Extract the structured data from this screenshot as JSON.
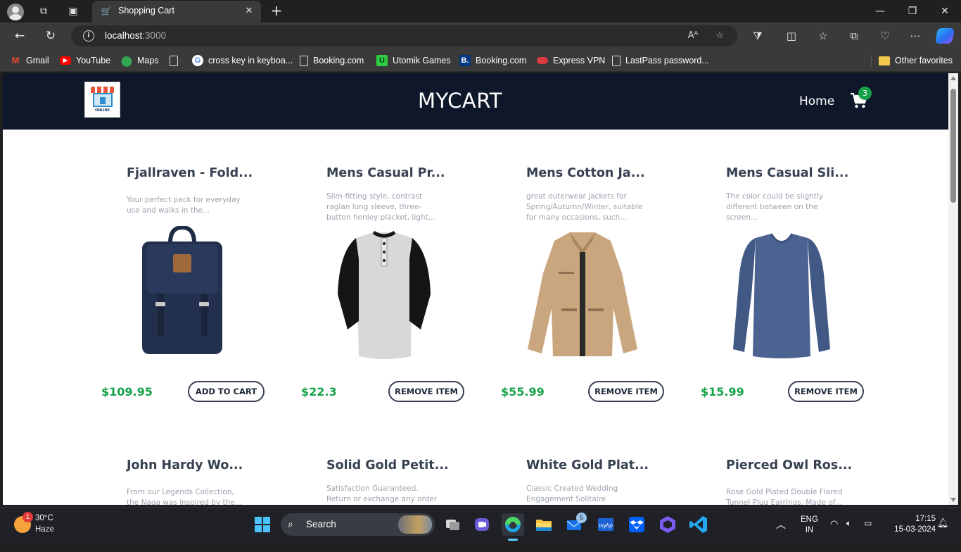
{
  "browser": {
    "tab_title": "Shopping Cart",
    "address_host": "localhost",
    "address_port": ":3000",
    "bookmarks": [
      {
        "label": "Gmail",
        "icon": "gmail-icon",
        "color": "#ea4335"
      },
      {
        "label": "YouTube",
        "icon": "youtube-icon",
        "color": "#ff0000"
      },
      {
        "label": "Maps",
        "icon": "maps-icon",
        "color": "#34a853"
      },
      {
        "label": "",
        "icon": "page-icon",
        "color": "#dcdcdc"
      },
      {
        "label": "cross key in keyboa...",
        "icon": "google-icon",
        "color": "#4285f4"
      },
      {
        "label": "Booking.com",
        "icon": "page-icon",
        "color": "#dcdcdc"
      },
      {
        "label": "Utomik Games",
        "icon": "utomik-icon",
        "color": "#2ecc40"
      },
      {
        "label": "Booking.com",
        "icon": "booking-icon",
        "color": "#003580"
      },
      {
        "label": "Express VPN",
        "icon": "expressvpn-icon",
        "color": "#da3940"
      },
      {
        "label": "LastPass password...",
        "icon": "page-icon",
        "color": "#dcdcdc"
      },
      {
        "label": "Other favorites",
        "icon": "folder-icon",
        "color": "#f2c94c"
      }
    ]
  },
  "site": {
    "brand": "MYCART",
    "logo_text": "ONLINE",
    "nav_home": "Home",
    "cart_count": "3",
    "colors": {
      "navbar": "#0f172a",
      "price": "#16a34a",
      "badge": "#16a34a"
    }
  },
  "products": [
    {
      "title": "Fjallraven - Fold...",
      "desc": "Your perfect pack for everyday use and walks in the...",
      "price": "$109.95",
      "button": "ADD TO CART",
      "image": "backpack-image"
    },
    {
      "title": "Mens Casual Pr...",
      "desc": "Slim-fitting style, contrast raglan long sleeve, three-button henley placket, light...",
      "price": "$22.3",
      "button": "REMOVE ITEM",
      "image": "henley-shirt-image"
    },
    {
      "title": "Mens Cotton Ja...",
      "desc": "great outerwear jackets for Spring/Autumn/Winter, suitable for many occasions, such...",
      "price": "$55.99",
      "button": "REMOVE ITEM",
      "image": "jacket-image"
    },
    {
      "title": "Mens Casual Sli...",
      "desc": "The color could be slightly different between on the screen...",
      "price": "$15.99",
      "button": "REMOVE ITEM",
      "image": "tshirt-image"
    },
    {
      "title": "John Hardy Wo...",
      "desc": "From our Legends Collection, the Naga was inspired by the..."
    },
    {
      "title": "Solid Gold Petit...",
      "desc": "Satisfaction Guaranteed. Return or exchange any order within..."
    },
    {
      "title": "White Gold Plat...",
      "desc": "Classic Created Wedding Engagement Solitaire Diamond..."
    },
    {
      "title": "Pierced Owl Ros...",
      "desc": "Rose Gold Plated Double Flared Tunnel Plug Earrings. Made of..."
    }
  ],
  "taskbar": {
    "weather_temp": "30°C",
    "weather_desc": "Haze",
    "weather_badge": "1",
    "search_label": "Search",
    "mail_badge": "5",
    "lang": "ENG",
    "region": "IN",
    "time": "17:15",
    "date": "15-03-2024"
  }
}
